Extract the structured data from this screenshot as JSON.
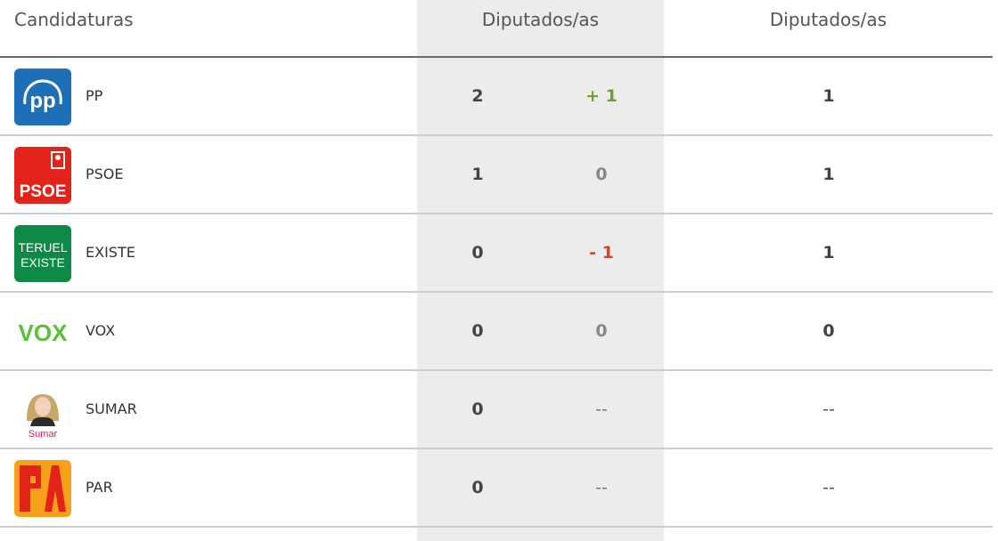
{
  "header": {
    "candidatures_label": "Candidaturas",
    "col1_label": "Diputados/as",
    "col2_label": "Diputados/as"
  },
  "rows": [
    {
      "party": "PP",
      "logo": "pp-logo",
      "seats": "2",
      "change": "+ 1",
      "change_type": "up",
      "previous": "1"
    },
    {
      "party": "PSOE",
      "logo": "psoe-logo",
      "seats": "1",
      "change": "0",
      "change_type": "same",
      "previous": "1"
    },
    {
      "party": "EXISTE",
      "logo": "teruel-existe-logo",
      "logo_text_1": "TERUEL",
      "logo_text_2": "EXISTE",
      "seats": "0",
      "change": "- 1",
      "change_type": "down",
      "previous": "1"
    },
    {
      "party": "VOX",
      "logo": "vox-logo",
      "logo_text": "VOX",
      "seats": "0",
      "change": "0",
      "change_type": "same",
      "previous": "0"
    },
    {
      "party": "SUMAR",
      "logo": "sumar-logo",
      "logo_text": "Sumar",
      "seats": "0",
      "change": "--",
      "change_type": "none",
      "previous": "--"
    },
    {
      "party": "PAR",
      "logo": "par-logo",
      "seats": "0",
      "change": "--",
      "change_type": "none",
      "previous": "--"
    }
  ],
  "colors": {
    "pp": "#1d6fb8",
    "psoe": "#e2231a",
    "teruel_existe": "#0f8a46",
    "vox": "#5ac035",
    "sumar": "#e5186a",
    "par": "#f7a11a",
    "up": "#6aa42b",
    "down": "#d9412c"
  }
}
